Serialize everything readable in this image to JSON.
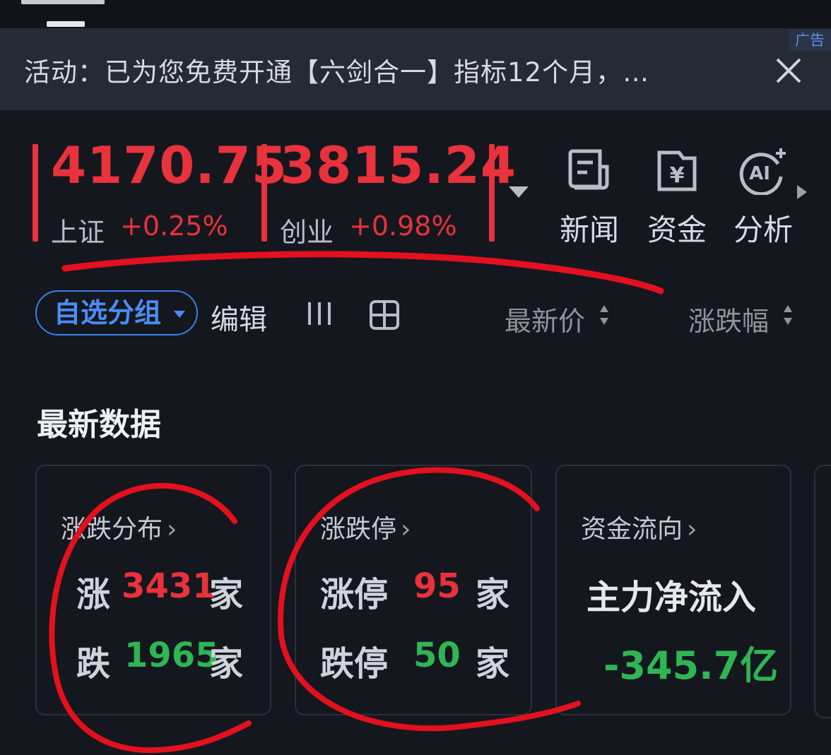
{
  "banner": {
    "text": "活动：已为您免费开通【六剑合一】指标12个月，…",
    "ad_label": "广告"
  },
  "indices": [
    {
      "value": "4170.75",
      "name": "上证",
      "change": "+0.25%"
    },
    {
      "value": "3815.24",
      "name": "创业",
      "change": "+0.98%"
    }
  ],
  "tools": [
    {
      "label": "新闻",
      "icon": "news-icon"
    },
    {
      "label": "资金",
      "icon": "funds-icon"
    },
    {
      "label": "分析",
      "icon": "ai-analysis-icon"
    }
  ],
  "toolbar": {
    "group_label": "自选分组",
    "edit_label": "编辑",
    "sort_latest_price": "最新价",
    "sort_change_pct": "涨跌幅"
  },
  "latest": {
    "title": "最新数据",
    "distribution": {
      "title": "涨跌分布",
      "up_label": "涨",
      "up_count": "3431",
      "down_label": "跌",
      "down_count": "1965",
      "unit": "家"
    },
    "limit": {
      "title": "涨跌停",
      "up_label": "涨停",
      "up_count": "95",
      "down_label": "跌停",
      "down_count": "50",
      "unit": "家"
    },
    "flow": {
      "title": "资金流向",
      "label": "主力净流入",
      "value": "-345.7亿"
    }
  },
  "colors": {
    "up": "#e8323c",
    "down": "#2fb553",
    "accent": "#3a7ff0",
    "background": "#15171e"
  }
}
